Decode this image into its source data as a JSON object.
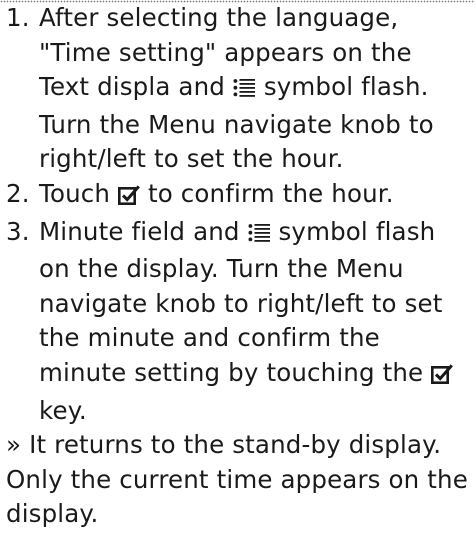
{
  "steps": [
    {
      "number": "1.",
      "text_before_icon": "After selecting the language, \"Time setting\" appears on the Text displa and ",
      "icon": "menu-list-icon",
      "text_after_icon": " symbol flash. Turn the Menu navigate knob to right/left to set the hour."
    },
    {
      "number": "2.",
      "text_before_icon": "Touch ",
      "icon": "checkbox-check-icon",
      "text_after_icon": " to confirm the hour."
    },
    {
      "number": "3.",
      "text_before_icon": "Minute field and ",
      "icon": "menu-list-icon",
      "text_middle": " symbol flash on the display. Turn the Menu navigate knob to right/left to set the minute and confirm the minute setting by touching the ",
      "icon_2": "checkbox-check-icon",
      "text_after_icon": " key."
    }
  ],
  "result_note": "» It returns to the stand-by display. Only the current time appears on the display."
}
